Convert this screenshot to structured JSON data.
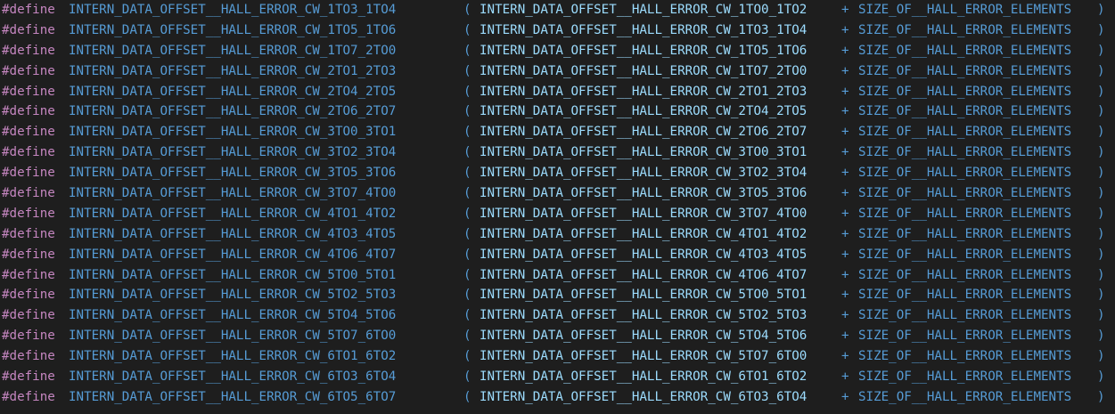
{
  "theme": {
    "background": "#1e1e1e",
    "keyword_color": "#c586c0",
    "macro_color": "#569cd6",
    "reference_color": "#9cdcfe",
    "punctuation_color": "#569cd6"
  },
  "code": {
    "keyword": "#define",
    "plus": "+",
    "paren_open": "(",
    "paren_close": ")",
    "size_macro": "SIZE_OF__HALL_ERROR_ELEMENTS",
    "lines": [
      {
        "name": "INTERN_DATA_OFFSET__HALL_ERROR_CW_1TO3_1TO4",
        "ref": "INTERN_DATA_OFFSET__HALL_ERROR_CW_1TO0_1TO2"
      },
      {
        "name": "INTERN_DATA_OFFSET__HALL_ERROR_CW_1TO5_1TO6",
        "ref": "INTERN_DATA_OFFSET__HALL_ERROR_CW_1TO3_1TO4"
      },
      {
        "name": "INTERN_DATA_OFFSET__HALL_ERROR_CW_1TO7_2TO0",
        "ref": "INTERN_DATA_OFFSET__HALL_ERROR_CW_1TO5_1TO6"
      },
      {
        "name": "INTERN_DATA_OFFSET__HALL_ERROR_CW_2TO1_2TO3",
        "ref": "INTERN_DATA_OFFSET__HALL_ERROR_CW_1TO7_2TO0"
      },
      {
        "name": "INTERN_DATA_OFFSET__HALL_ERROR_CW_2TO4_2TO5",
        "ref": "INTERN_DATA_OFFSET__HALL_ERROR_CW_2TO1_2TO3"
      },
      {
        "name": "INTERN_DATA_OFFSET__HALL_ERROR_CW_2TO6_2TO7",
        "ref": "INTERN_DATA_OFFSET__HALL_ERROR_CW_2TO4_2TO5"
      },
      {
        "name": "INTERN_DATA_OFFSET__HALL_ERROR_CW_3TO0_3TO1",
        "ref": "INTERN_DATA_OFFSET__HALL_ERROR_CW_2TO6_2TO7"
      },
      {
        "name": "INTERN_DATA_OFFSET__HALL_ERROR_CW_3TO2_3TO4",
        "ref": "INTERN_DATA_OFFSET__HALL_ERROR_CW_3TO0_3TO1"
      },
      {
        "name": "INTERN_DATA_OFFSET__HALL_ERROR_CW_3TO5_3TO6",
        "ref": "INTERN_DATA_OFFSET__HALL_ERROR_CW_3TO2_3TO4"
      },
      {
        "name": "INTERN_DATA_OFFSET__HALL_ERROR_CW_3TO7_4TO0",
        "ref": "INTERN_DATA_OFFSET__HALL_ERROR_CW_3TO5_3TO6"
      },
      {
        "name": "INTERN_DATA_OFFSET__HALL_ERROR_CW_4TO1_4TO2",
        "ref": "INTERN_DATA_OFFSET__HALL_ERROR_CW_3TO7_4TO0"
      },
      {
        "name": "INTERN_DATA_OFFSET__HALL_ERROR_CW_4TO3_4TO5",
        "ref": "INTERN_DATA_OFFSET__HALL_ERROR_CW_4TO1_4TO2"
      },
      {
        "name": "INTERN_DATA_OFFSET__HALL_ERROR_CW_4TO6_4TO7",
        "ref": "INTERN_DATA_OFFSET__HALL_ERROR_CW_4TO3_4TO5"
      },
      {
        "name": "INTERN_DATA_OFFSET__HALL_ERROR_CW_5TO0_5TO1",
        "ref": "INTERN_DATA_OFFSET__HALL_ERROR_CW_4TO6_4TO7"
      },
      {
        "name": "INTERN_DATA_OFFSET__HALL_ERROR_CW_5TO2_5TO3",
        "ref": "INTERN_DATA_OFFSET__HALL_ERROR_CW_5TO0_5TO1"
      },
      {
        "name": "INTERN_DATA_OFFSET__HALL_ERROR_CW_5TO4_5TO6",
        "ref": "INTERN_DATA_OFFSET__HALL_ERROR_CW_5TO2_5TO3"
      },
      {
        "name": "INTERN_DATA_OFFSET__HALL_ERROR_CW_5TO7_6TO0",
        "ref": "INTERN_DATA_OFFSET__HALL_ERROR_CW_5TO4_5TO6"
      },
      {
        "name": "INTERN_DATA_OFFSET__HALL_ERROR_CW_6TO1_6TO2",
        "ref": "INTERN_DATA_OFFSET__HALL_ERROR_CW_5TO7_6TO0"
      },
      {
        "name": "INTERN_DATA_OFFSET__HALL_ERROR_CW_6TO3_6TO4",
        "ref": "INTERN_DATA_OFFSET__HALL_ERROR_CW_6TO1_6TO2"
      },
      {
        "name": "INTERN_DATA_OFFSET__HALL_ERROR_CW_6TO5_6TO7",
        "ref": "INTERN_DATA_OFFSET__HALL_ERROR_CW_6TO3_6TO4"
      }
    ]
  }
}
